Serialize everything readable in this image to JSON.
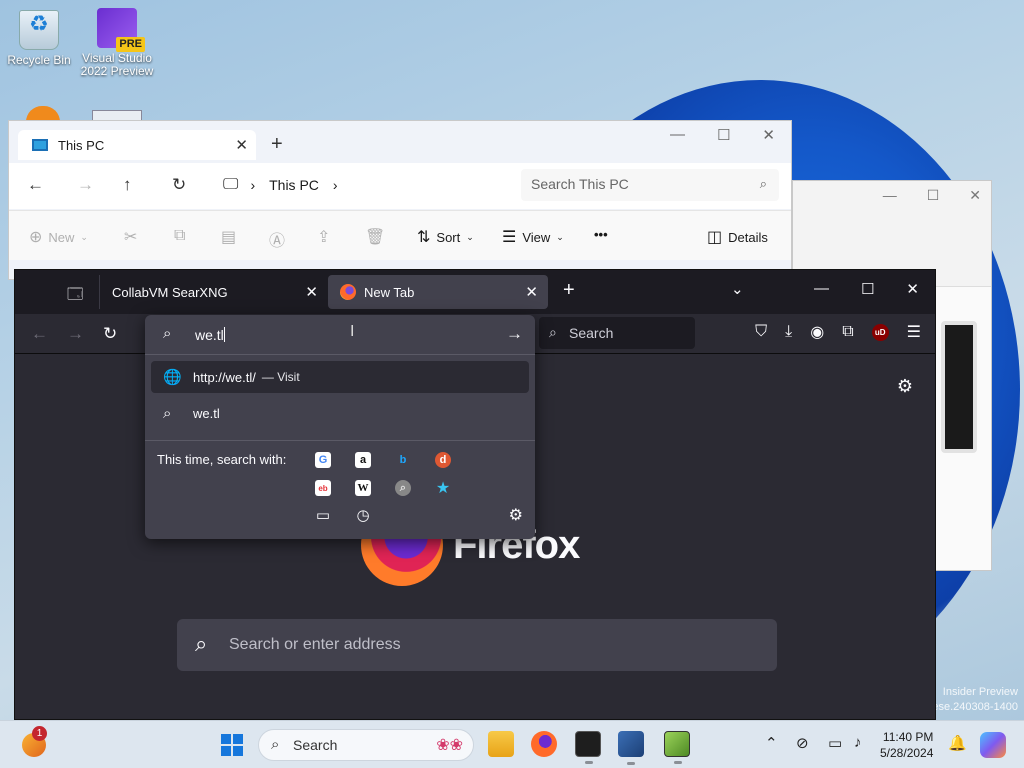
{
  "desktop": {
    "icons": [
      {
        "label_line1": "Recycle Bin",
        "label_line2": ""
      },
      {
        "label_line1": "Visual Studio",
        "label_line2": "2022 Preview",
        "badge": "PRE"
      }
    ],
    "watermark_line1": "Insider Preview",
    "watermark_line2": "ese.240308-1400"
  },
  "explorer": {
    "tab_title": "This PC",
    "breadcrumb": "This PC",
    "search_placeholder": "Search This PC",
    "toolbar": {
      "new": "New",
      "sort": "Sort",
      "view": "View",
      "more": "•••",
      "details": "Details"
    }
  },
  "firefox": {
    "tabs": [
      {
        "title": "CollabVM SearXNG",
        "active": false
      },
      {
        "title": "New Tab",
        "active": true
      }
    ],
    "nav_search_placeholder": "Search",
    "extension_badge": "uD",
    "brand_text": "Firefox",
    "newtab_search_placeholder": "Search or enter address",
    "urlbar": {
      "typed_value": "we.tl",
      "suggestions": [
        {
          "text": "http://we.tl/",
          "action": "— Visit",
          "icon": "globe-icon",
          "selected": true
        },
        {
          "text": "we.tl",
          "action": "",
          "icon": "search-icon",
          "selected": false
        }
      ],
      "search_with_label": "This time, search with:",
      "engines": [
        "Google",
        "Amazon",
        "Bing",
        "DuckDuckGo",
        "eBay",
        "Wikipedia",
        "Other",
        "Bookmarks",
        "Tabs",
        "History"
      ]
    }
  },
  "taskbar": {
    "weather_badge": "1",
    "search_placeholder": "Search",
    "clock_time": "11:40 PM",
    "clock_date": "5/28/2024",
    "apps": [
      "File Explorer",
      "Firefox",
      "Terminal",
      "VirtualBox",
      "Notepad++"
    ]
  },
  "colors": {
    "firefox_bg": "#2b2a33",
    "firefox_tabbar": "#1c1b22",
    "accent": "#1677dc"
  }
}
